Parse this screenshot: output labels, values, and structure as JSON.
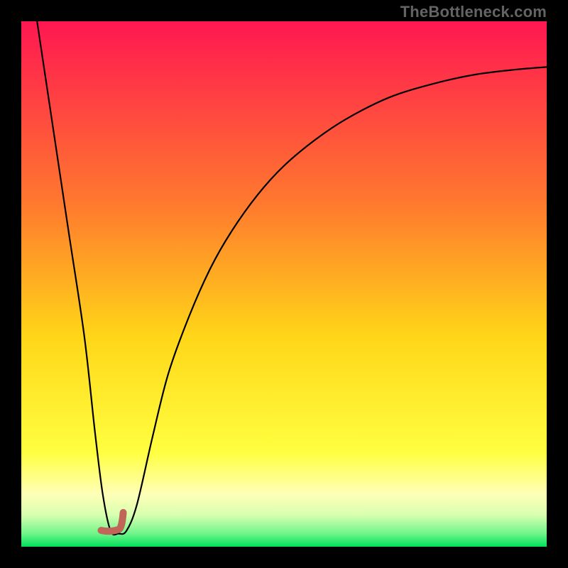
{
  "attribution": {
    "text": "TheBottleneck.com"
  },
  "chart_data": {
    "type": "line",
    "title": "",
    "xlabel": "",
    "ylabel": "",
    "xlim": [
      0,
      100
    ],
    "ylim": [
      0,
      100
    ],
    "grid": false,
    "legend": false,
    "background_gradient": {
      "stops": [
        {
          "offset": 0.0,
          "color": "#ff1751"
        },
        {
          "offset": 0.35,
          "color": "#ff7a2e"
        },
        {
          "offset": 0.6,
          "color": "#ffd618"
        },
        {
          "offset": 0.82,
          "color": "#ffff40"
        },
        {
          "offset": 0.9,
          "color": "#ffffb8"
        },
        {
          "offset": 0.94,
          "color": "#d8ffb0"
        },
        {
          "offset": 0.975,
          "color": "#70f58a"
        },
        {
          "offset": 1.0,
          "color": "#00e05c"
        }
      ]
    },
    "series": [
      {
        "name": "bottleneck-curve",
        "color": "#000000",
        "stroke_width": 2.2,
        "x": [
          3,
          6,
          9,
          12,
          14,
          15.5,
          17,
          18.5,
          20,
          22,
          25,
          28,
          32,
          36,
          40,
          45,
          50,
          56,
          62,
          70,
          78,
          86,
          94,
          100
        ],
        "y": [
          100,
          80,
          60,
          40,
          22,
          10,
          3,
          2.5,
          3,
          8,
          21,
          33,
          44,
          53,
          60,
          67,
          72.5,
          77.5,
          81.5,
          85.5,
          88,
          89.8,
          90.8,
          91.3
        ]
      }
    ],
    "marker": {
      "name": "bottleneck-minimum",
      "color": "#c16558",
      "cap_stroke_width": 10,
      "points": [
        {
          "x": 15.2,
          "y": 3.1
        },
        {
          "x": 18.6,
          "y": 3.3
        }
      ],
      "hook_end": {
        "x": 19.4,
        "y": 6.5
      }
    }
  }
}
